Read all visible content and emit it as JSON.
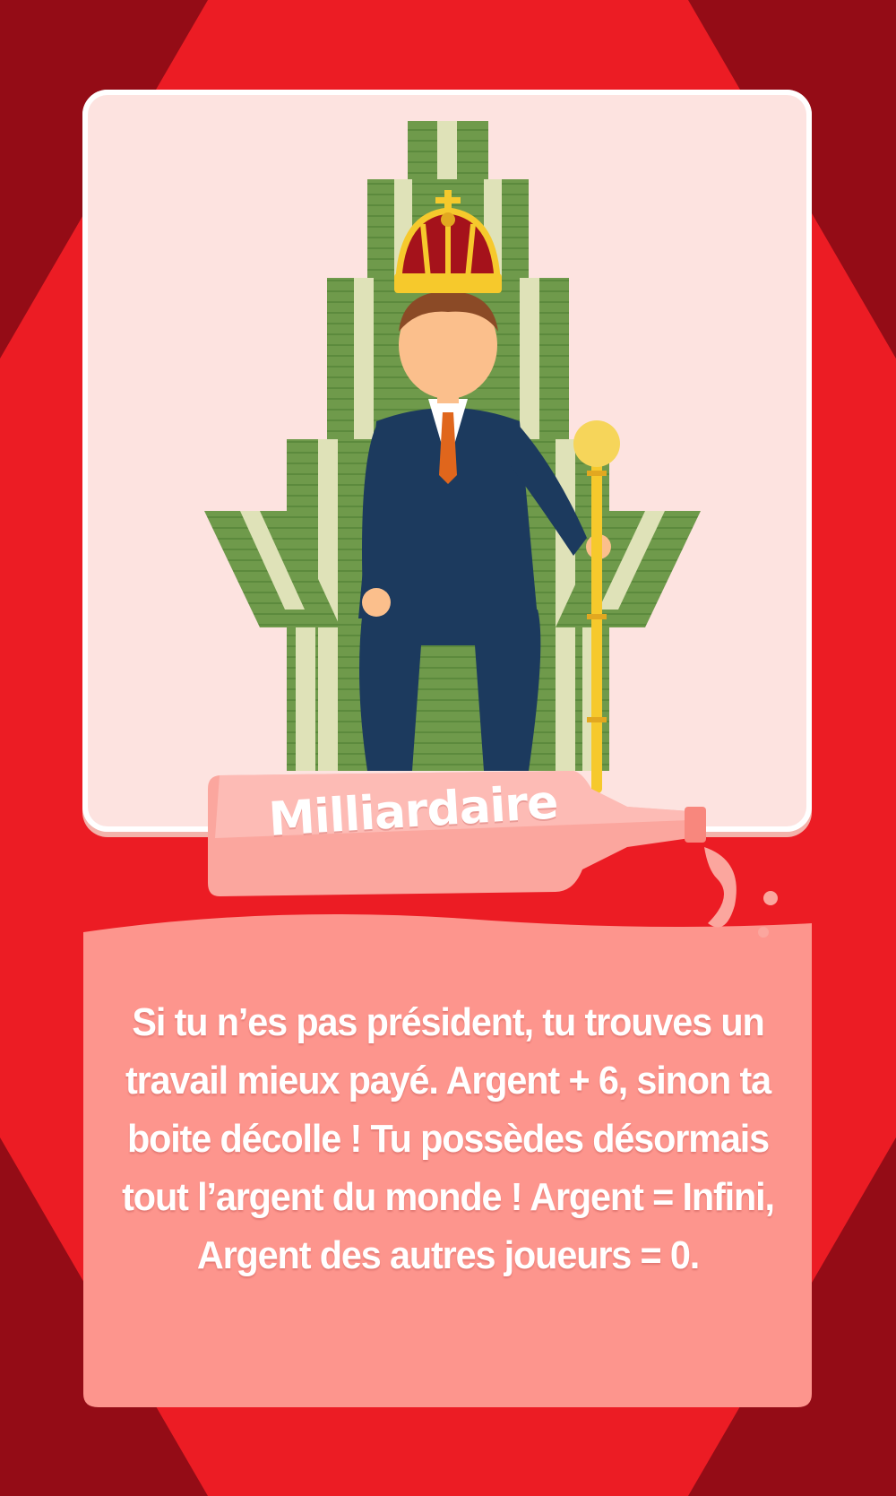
{
  "card": {
    "title": "Milliardaire",
    "description": "Si tu n’es pas président, tu trouves un travail mieux payé. Argent + 6, sinon ta boite décolle ! Tu possèdes désormais tout l’argent du monde ! Argent = Infini, Argent des autres joueurs = 0."
  },
  "colors": {
    "background_dark": "#940c16",
    "background_red": "#ec1c24",
    "panel_light": "#fde3e0",
    "text_panel": "#fd958d",
    "money_green": "#6f9a4b",
    "suit_navy": "#1c3a5e",
    "gold": "#f6c92c"
  },
  "icons": [
    "money-throne-icon",
    "crown-icon",
    "scepter-icon",
    "bottle-icon"
  ]
}
